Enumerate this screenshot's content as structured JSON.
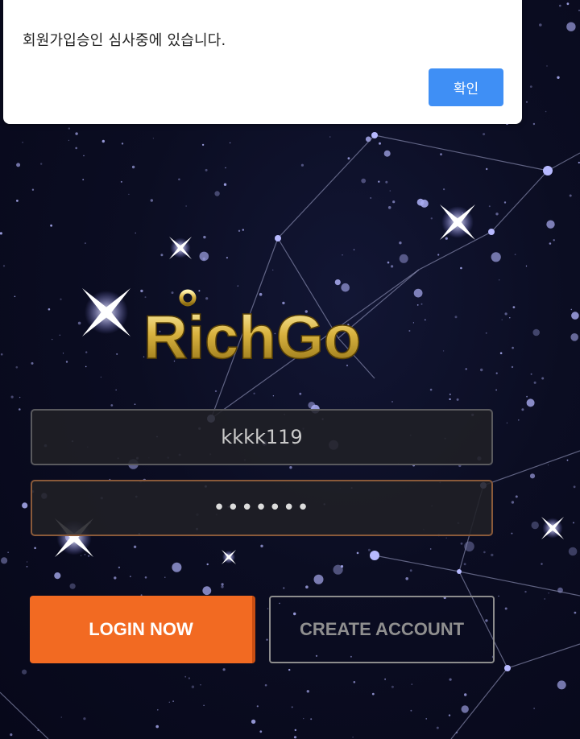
{
  "dialog": {
    "message": "회원가입승인 심사중에 있습니다.",
    "ok_label": "확인",
    "ok_color": "#3f8ff5"
  },
  "logo": {
    "text": "RichGo",
    "color": "#c9a73a"
  },
  "login_form": {
    "username_value": "kkkk119",
    "password_value": "•••••••"
  },
  "buttons": {
    "login_label": "LOGIN NOW",
    "create_label": "CREATE ACCOUNT",
    "login_color": "#f26a22"
  },
  "background": {
    "theme": "starry-night",
    "base_color": "#0b0d22"
  }
}
